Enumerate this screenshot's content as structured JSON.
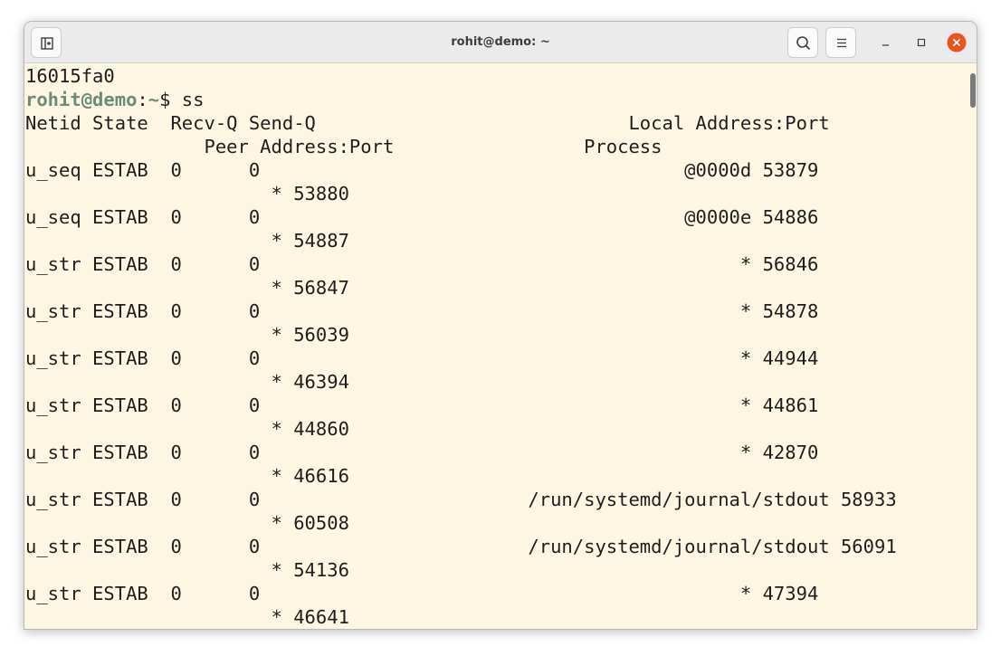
{
  "window": {
    "title": "rohit@demo: ~"
  },
  "icons": {
    "new_tab": "new-tab-icon",
    "search": "search-icon",
    "menu": "hamburger-menu-icon",
    "minimize": "minimize-icon",
    "maximize": "maximize-icon",
    "close": "close-icon"
  },
  "colors": {
    "terminal_bg": "#fdf6e3",
    "prompt": "#6b8d77",
    "close_button": "#e95420"
  },
  "terminal": {
    "previous_output": "16015fa0",
    "prompt": {
      "user_host": "rohit@demo",
      "separator": ":",
      "path": "~",
      "symbol": "$ ",
      "command": "ss"
    },
    "output_lines": [
      "Netid State  Recv-Q Send-Q                            Local Address:Port",
      "                Peer Address:Port                 Process",
      "u_seq ESTAB  0      0                                      @0000d 53879",
      "                      * 53880",
      "u_seq ESTAB  0      0                                      @0000e 54886",
      "                      * 54887",
      "u_str ESTAB  0      0                                           * 56846",
      "                      * 56847",
      "u_str ESTAB  0      0                                           * 54878",
      "                      * 56039",
      "u_str ESTAB  0      0                                           * 44944",
      "                      * 46394",
      "u_str ESTAB  0      0                                           * 44861",
      "                      * 44860",
      "u_str ESTAB  0      0                                           * 42870",
      "                      * 46616",
      "u_str ESTAB  0      0                        /run/systemd/journal/stdout 58933",
      "                      * 60508",
      "u_str ESTAB  0      0                        /run/systemd/journal/stdout 56091",
      "                      * 54136",
      "u_str ESTAB  0      0                                           * 47394",
      "                      * 46641"
    ]
  }
}
